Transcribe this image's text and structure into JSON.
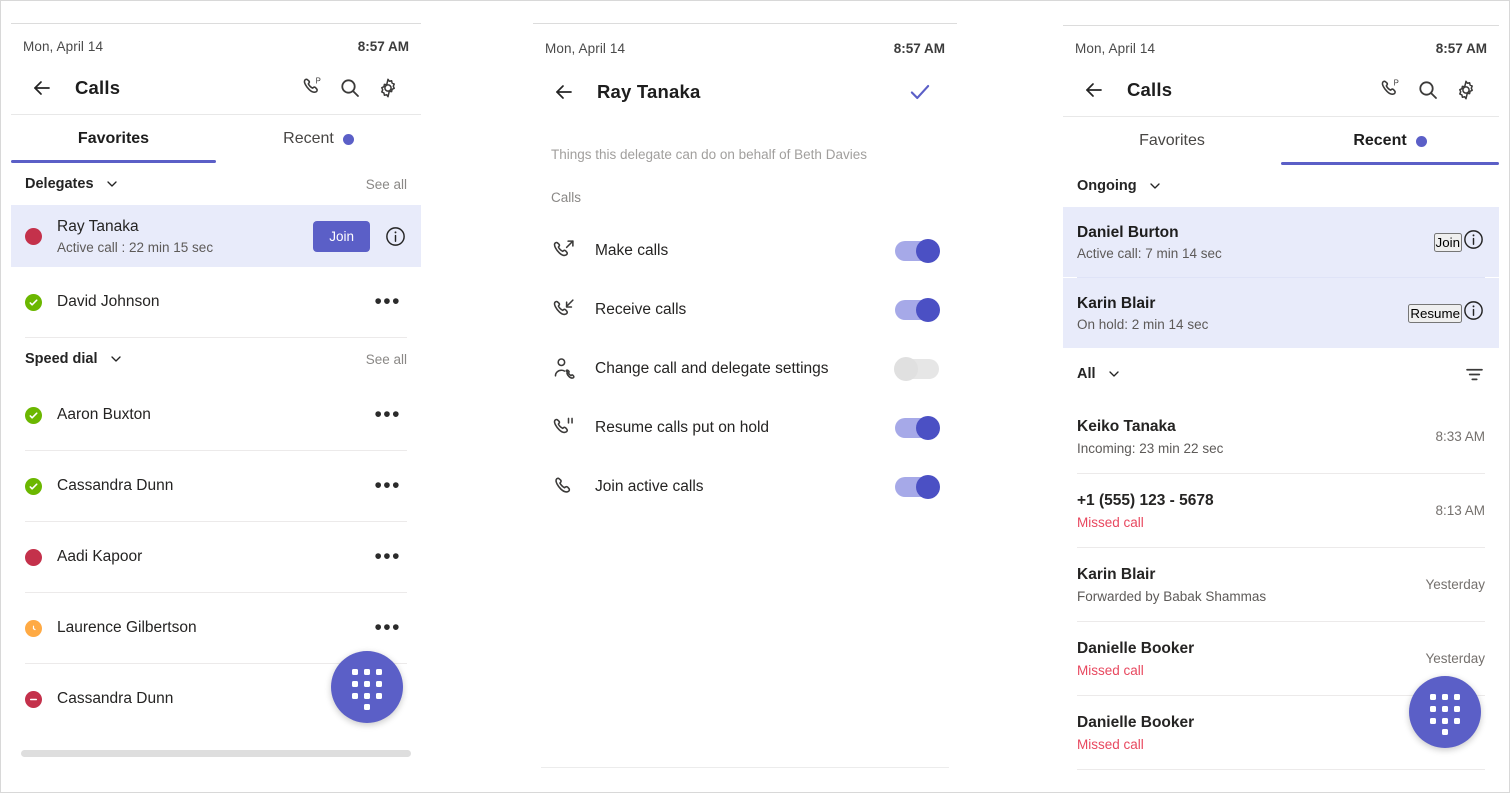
{
  "status_bar": {
    "date": "Mon, April 14",
    "time": "8:57 AM"
  },
  "colors": {
    "accent": "#5b5fc7",
    "highlight_row": "#e8ebfa",
    "available": "#6bb700",
    "busy": "#c4314b",
    "away": "#ffaa44",
    "dnd": "#c4314b",
    "missed": "#e8485f"
  },
  "panel1": {
    "header": {
      "back_icon": "arrow-left-icon",
      "title": "Calls",
      "actions": [
        {
          "icon": "call-park-icon"
        },
        {
          "icon": "search-icon"
        },
        {
          "icon": "gear-icon"
        }
      ]
    },
    "tabs": [
      {
        "label": "Favorites",
        "active": true,
        "badge": false
      },
      {
        "label": "Recent",
        "active": false,
        "badge": true
      }
    ],
    "delegates_section": {
      "label": "Delegates",
      "chevron": "chevron-down-icon",
      "see_all": "See all"
    },
    "delegate": {
      "name": "Ray Tanaka",
      "status_text": "Active call : 22 min 15 sec",
      "presence": "busy",
      "button": "Join",
      "info_icon": "info-icon"
    },
    "delegate_contact": {
      "name": "David Johnson",
      "presence": "available",
      "more": "•••"
    },
    "speed_dial_section": {
      "label": "Speed dial",
      "chevron": "chevron-down-icon",
      "see_all": "See all"
    },
    "speed_dial": [
      {
        "name": "Aaron Buxton",
        "presence": "available"
      },
      {
        "name": "Cassandra Dunn",
        "presence": "available"
      },
      {
        "name": "Aadi Kapoor",
        "presence": "busy"
      },
      {
        "name": "Laurence Gilbertson",
        "presence": "away"
      },
      {
        "name": "Cassandra Dunn",
        "presence": "dnd"
      }
    ],
    "more_glyph": "•••",
    "fab": {
      "icon": "dialpad-icon"
    }
  },
  "panel2": {
    "header": {
      "back_icon": "arrow-left-icon",
      "title": "Ray Tanaka",
      "confirm_icon": "checkmark-icon"
    },
    "note": "Things this delegate can do on behalf of Beth Davies",
    "group_label": "Calls",
    "permissions": [
      {
        "label": "Make calls",
        "icon": "call-outgoing-icon",
        "on": true
      },
      {
        "label": "Receive calls",
        "icon": "call-incoming-icon",
        "on": true
      },
      {
        "label": "Change call and delegate settings",
        "icon": "person-call-icon",
        "on": false
      },
      {
        "label": "Resume calls put on hold",
        "icon": "call-hold-icon",
        "on": true
      },
      {
        "label": "Join active calls",
        "icon": "call-icon",
        "on": true
      }
    ]
  },
  "panel3": {
    "header": {
      "back_icon": "arrow-left-icon",
      "title": "Calls",
      "actions": [
        {
          "icon": "call-park-icon"
        },
        {
          "icon": "search-icon"
        },
        {
          "icon": "gear-icon"
        }
      ]
    },
    "tabs": [
      {
        "label": "Favorites",
        "active": false,
        "badge": false
      },
      {
        "label": "Recent",
        "active": true,
        "badge": true
      }
    ],
    "ongoing_section": {
      "label": "Ongoing",
      "chevron": "chevron-down-icon"
    },
    "ongoing": [
      {
        "name": "Daniel Burton",
        "status_text": "Active call: 7 min 14 sec",
        "button": "Join",
        "info_icon": "info-icon"
      },
      {
        "name": "Karin Blair",
        "status_text": "On hold: 2 min 14 sec",
        "button": "Resume",
        "info_icon": "info-icon"
      }
    ],
    "filter_section": {
      "label": "All",
      "chevron": "chevron-down-icon",
      "filter_icon": "filter-icon"
    },
    "recent": [
      {
        "name": "Keiko Tanaka",
        "sub": "Incoming: 23 min 22 sec",
        "missed": false,
        "time": "8:33 AM"
      },
      {
        "name": "+1 (555) 123 - 5678",
        "sub": "Missed call",
        "missed": true,
        "time": "8:13 AM"
      },
      {
        "name": "Karin Blair",
        "sub": "Forwarded by Babak Shammas",
        "missed": false,
        "time": "Yesterday"
      },
      {
        "name": "Danielle Booker",
        "sub": "Missed call",
        "missed": true,
        "time": "Yesterday"
      },
      {
        "name": "Danielle Booker",
        "sub": "Missed call",
        "missed": true,
        "time": ""
      }
    ],
    "fab": {
      "icon": "dialpad-icon"
    }
  }
}
